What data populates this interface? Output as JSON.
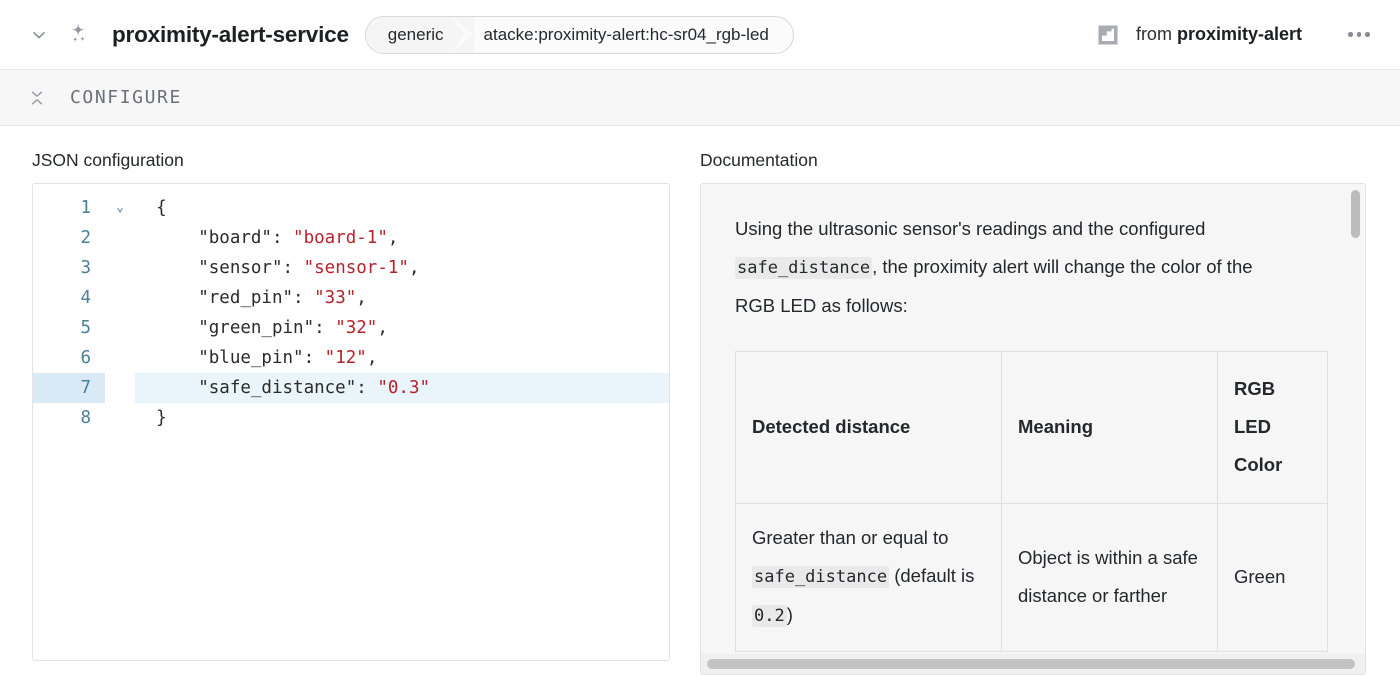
{
  "header": {
    "toggle_icon": "chevron-down-icon",
    "service_icon": "sparkles-icon",
    "title": "proximity-alert-service",
    "breadcrumb": {
      "kind": "generic",
      "path": "atacke:proximity-alert:hc-sr04_rgb-led"
    },
    "source_icon": "layout-blueprint-icon",
    "source_prefix": "from ",
    "source_name": "proximity-alert",
    "overflow_icon": "ellipsis-horizontal-icon"
  },
  "configure": {
    "collapse_icon": "collapse-vertical-icon",
    "label": "CONFIGURE"
  },
  "editor": {
    "label": "JSON configuration",
    "fold_marker": "⌄",
    "active_line": 7,
    "lines": [
      {
        "num": "1",
        "fold": true,
        "text": "{"
      },
      {
        "num": "2",
        "fold": false,
        "key": "\"board\"",
        "sep": ": ",
        "value": "\"board-1\"",
        "tail": ","
      },
      {
        "num": "3",
        "fold": false,
        "key": "\"sensor\"",
        "sep": ": ",
        "value": "\"sensor-1\"",
        "tail": ","
      },
      {
        "num": "4",
        "fold": false,
        "key": "\"red_pin\"",
        "sep": ": ",
        "value": "\"33\"",
        "tail": ","
      },
      {
        "num": "5",
        "fold": false,
        "key": "\"green_pin\"",
        "sep": ": ",
        "value": "\"32\"",
        "tail": ","
      },
      {
        "num": "6",
        "fold": false,
        "key": "\"blue_pin\"",
        "sep": ": ",
        "value": "\"12\"",
        "tail": ","
      },
      {
        "num": "7",
        "fold": false,
        "key": "\"safe_distance\"",
        "sep": ": ",
        "value": "\"0.3\"",
        "tail": ""
      },
      {
        "num": "8",
        "fold": false,
        "text": "}"
      }
    ],
    "colors": {
      "gutter": "#4a7f99",
      "key": "#2b2b2b",
      "value": "#b4242b",
      "active_line_bg": "#eaf4fb",
      "active_gutter_bg": "#d9eaf6"
    }
  },
  "documentation": {
    "label": "Documentation",
    "paragraph": {
      "part1": "Using the ultrasonic sensor's readings and the configured ",
      "code": "safe_distance",
      "part2": ", the proximity alert will change the color of the RGB LED as follows:"
    },
    "table": {
      "headers": [
        "Detected distance",
        "Meaning",
        "RGB LED Color"
      ],
      "rows": [
        {
          "distance_pre": "Greater than or equal to ",
          "distance_code": "safe_distance",
          "distance_post_pre": " (default is ",
          "distance_post_code": "0.2",
          "distance_post_end": ")",
          "meaning": "Object is within a safe distance or farther",
          "color": "Green"
        }
      ]
    },
    "scrollbar": {
      "vertical_name": "doc-vertical-scrollbar",
      "horizontal_name": "doc-horizontal-scrollbar"
    }
  }
}
